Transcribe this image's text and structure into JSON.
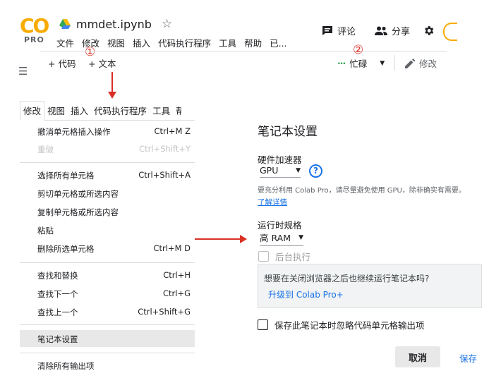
{
  "header": {
    "logo_text": "CO",
    "logo_sub": "PRO",
    "notebook_title": "mmdet.ipynb",
    "star_glyph": "☆",
    "menu": [
      "文件",
      "修改",
      "视图",
      "插入",
      "代码执行程序",
      "工具",
      "帮助",
      "已..."
    ],
    "comment_label": "评论",
    "share_label": "分享"
  },
  "toolbar": {
    "add_code": "+ 代码",
    "add_text": "+ 文本",
    "status": "忙碌",
    "edit_label": "修改"
  },
  "annotations": {
    "marker1": "①",
    "marker2": "②"
  },
  "edit_menu": {
    "tabs": [
      "修改",
      "视图",
      "插入",
      "代码执行程序",
      "工具",
      "帮"
    ],
    "items": [
      {
        "label": "撤消单元格插入操作",
        "shortcut": "Ctrl+M Z",
        "disabled": false
      },
      {
        "label": "重做",
        "shortcut": "Ctrl+Shift+Y",
        "disabled": true
      },
      {
        "label": "选择所有单元格",
        "shortcut": "Ctrl+Shift+A",
        "disabled": false
      },
      {
        "label": "剪切单元格或所选内容",
        "shortcut": "",
        "disabled": false
      },
      {
        "label": "复制单元格或所选内容",
        "shortcut": "",
        "disabled": false
      },
      {
        "label": "粘贴",
        "shortcut": "",
        "disabled": false
      },
      {
        "label": "删除所选单元格",
        "shortcut": "Ctrl+M D",
        "disabled": false
      },
      {
        "label": "查找和替换",
        "shortcut": "Ctrl+H",
        "disabled": false
      },
      {
        "label": "查找下一个",
        "shortcut": "Ctrl+G",
        "disabled": false
      },
      {
        "label": "查找上一个",
        "shortcut": "Ctrl+Shift+G",
        "disabled": false
      },
      {
        "label": "笔记本设置",
        "shortcut": "",
        "disabled": false
      },
      {
        "label": "清除所有输出项",
        "shortcut": "",
        "disabled": false
      }
    ]
  },
  "dialog": {
    "title": "笔记本设置",
    "accelerator_label": "硬件加速器",
    "accelerator_value": "GPU",
    "help_glyph": "?",
    "hint": "要充分利用 Colab Pro，请尽量避免使用 GPU，除非确实有需要。",
    "learn_more": "了解详情",
    "runtime_label": "运行时规格",
    "runtime_value": "高 RAM",
    "background_label": "后台执行",
    "promo_text": "想要在关闭浏览器之后也继续运行笔记本吗?",
    "promo_link": "升级到 Colab Pro+",
    "omit_output_label": "保存此笔记本时忽略代码单元格输出项",
    "cancel": "取消",
    "save": "保存"
  },
  "colors": {
    "accent": "#1a73e8",
    "annotation_red": "#d93025",
    "logo_orange": "#f9ab00",
    "busy_green": "#34a853"
  }
}
